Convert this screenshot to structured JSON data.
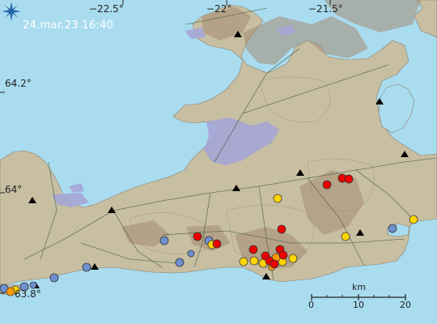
{
  "map": {
    "timestamp": "24.mar.23  16:40",
    "lon_labels": [
      "−22.5°",
      "−22°",
      "−21.5°"
    ],
    "lat_labels": [
      "64.2°",
      "64°",
      "63.8°"
    ],
    "scale": {
      "unit": "km",
      "ticks": [
        "0",
        "10",
        "20"
      ]
    },
    "colors": {
      "sea": "#a9dcef",
      "land": "#c8bea2",
      "urban": "#a6a6d6",
      "lake": "#a9dcef",
      "quake_recent": "#ee0000",
      "quake_day": "#ffd400",
      "quake_old": "#6f8fd0",
      "quake_week": "#ff9a00",
      "station": "#000000"
    },
    "logo": "star-logo-icon"
  }
}
